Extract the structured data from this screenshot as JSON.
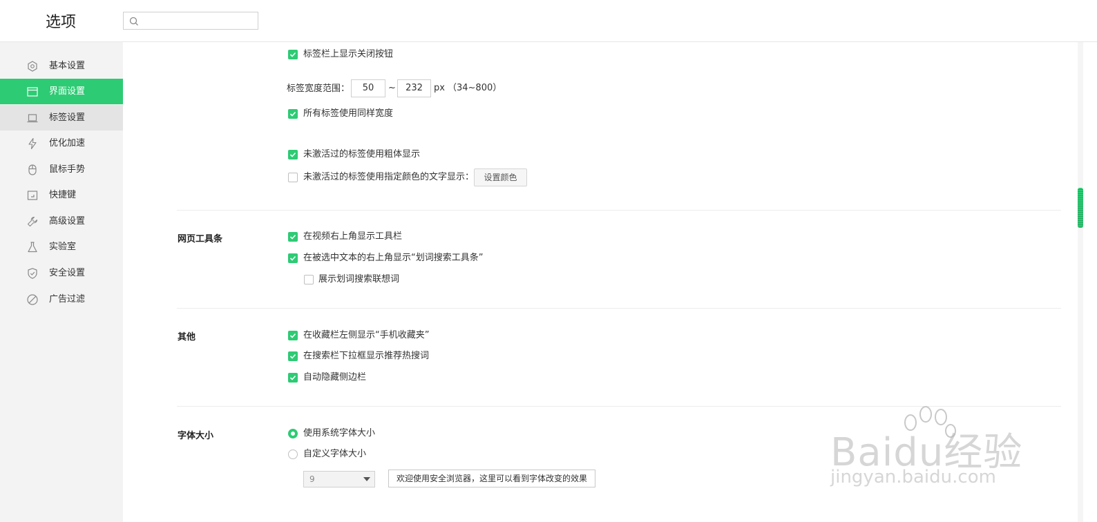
{
  "header": {
    "title": "选项",
    "search_placeholder": ""
  },
  "sidebar": {
    "items": [
      {
        "label": "基本设置",
        "icon": "hexagon-settings-icon"
      },
      {
        "label": "界面设置",
        "icon": "window-icon",
        "state": "active"
      },
      {
        "label": "标签设置",
        "icon": "tab-icon",
        "state": "hover"
      },
      {
        "label": "优化加速",
        "icon": "lightning-icon"
      },
      {
        "label": "鼠标手势",
        "icon": "mouse-icon"
      },
      {
        "label": "快捷键",
        "icon": "keyboard-shortcut-icon"
      },
      {
        "label": "高级设置",
        "icon": "wrench-icon"
      },
      {
        "label": "实验室",
        "icon": "flask-icon"
      },
      {
        "label": "安全设置",
        "icon": "shield-icon"
      },
      {
        "label": "广告过滤",
        "icon": "block-icon"
      }
    ]
  },
  "tabs_section": {
    "show_close_button": {
      "label": "标签栏上显示关闭按钮",
      "checked": true
    },
    "width_range": {
      "label": "标签宽度范围：",
      "min": "50",
      "separator": "~",
      "max": "232",
      "unit": "px",
      "hint": "（34~800）"
    },
    "same_width": {
      "label": "所有标签使用同样宽度",
      "checked": true
    },
    "inactive_bold": {
      "label": "未激活过的标签使用粗体显示",
      "checked": true
    },
    "inactive_color": {
      "label": "未激活过的标签使用指定颜色的文字显示：",
      "checked": false,
      "button": "设置颜色"
    }
  },
  "web_toolbar": {
    "title": "网页工具条",
    "video_toolbar": {
      "label": "在视频右上角显示工具栏",
      "checked": true
    },
    "selection_toolbar": {
      "label": "在被选中文本的右上角显示“划词搜索工具条”",
      "checked": true
    },
    "suggestions": {
      "label": "展示划词搜索联想词",
      "checked": false
    }
  },
  "other": {
    "title": "其他",
    "mobile_favorites": {
      "label": "在收藏栏左侧显示“手机收藏夹”",
      "checked": true
    },
    "hot_search": {
      "label": "在搜索栏下拉框显示推荐热搜词",
      "checked": true
    },
    "auto_hide_sidebar": {
      "label": "自动隐藏侧边栏",
      "checked": true
    }
  },
  "font_size": {
    "title": "字体大小",
    "system": {
      "label": "使用系统字体大小",
      "selected": true
    },
    "custom": {
      "label": "自定义字体大小",
      "selected": false
    },
    "size_value": "9",
    "preview_text": "欢迎使用安全浏览器，这里可以看到字体改变的效果"
  },
  "watermark": {
    "text": "Baidu经验",
    "url": "jingyan.baidu.com"
  },
  "colors": {
    "accent": "#2dcb74",
    "sidebar_bg": "#f3f3f3"
  }
}
